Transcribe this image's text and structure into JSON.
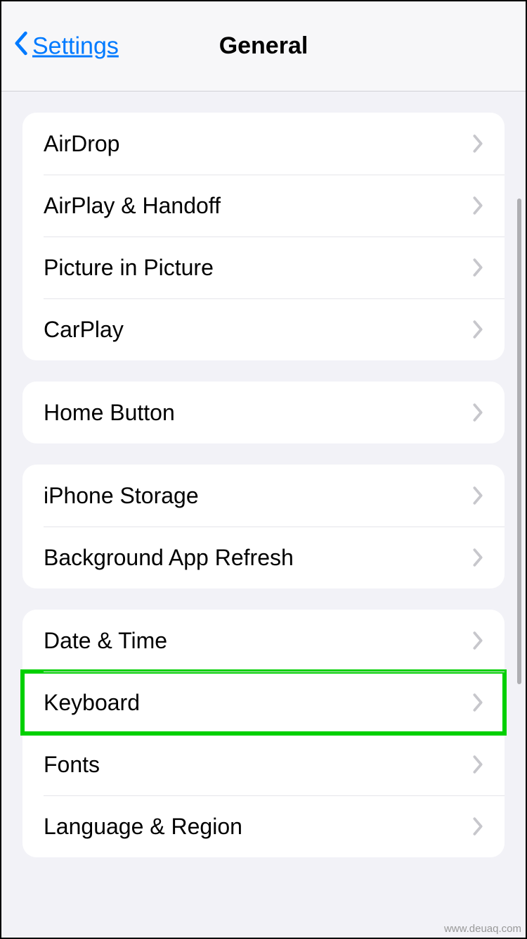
{
  "nav": {
    "back_label": "Settings",
    "title": "General"
  },
  "groups": [
    {
      "rows": [
        {
          "label": "AirDrop",
          "name": "row-airdrop"
        },
        {
          "label": "AirPlay & Handoff",
          "name": "row-airplay-handoff"
        },
        {
          "label": "Picture in Picture",
          "name": "row-picture-in-picture"
        },
        {
          "label": "CarPlay",
          "name": "row-carplay"
        }
      ]
    },
    {
      "rows": [
        {
          "label": "Home Button",
          "name": "row-home-button"
        }
      ]
    },
    {
      "rows": [
        {
          "label": "iPhone Storage",
          "name": "row-iphone-storage"
        },
        {
          "label": "Background App Refresh",
          "name": "row-background-app-refresh"
        }
      ]
    },
    {
      "rows": [
        {
          "label": "Date & Time",
          "name": "row-date-time"
        },
        {
          "label": "Keyboard",
          "name": "row-keyboard",
          "highlight": true
        },
        {
          "label": "Fonts",
          "name": "row-fonts"
        },
        {
          "label": "Language & Region",
          "name": "row-language-region"
        }
      ]
    }
  ],
  "footer": "www.deuaq.com"
}
